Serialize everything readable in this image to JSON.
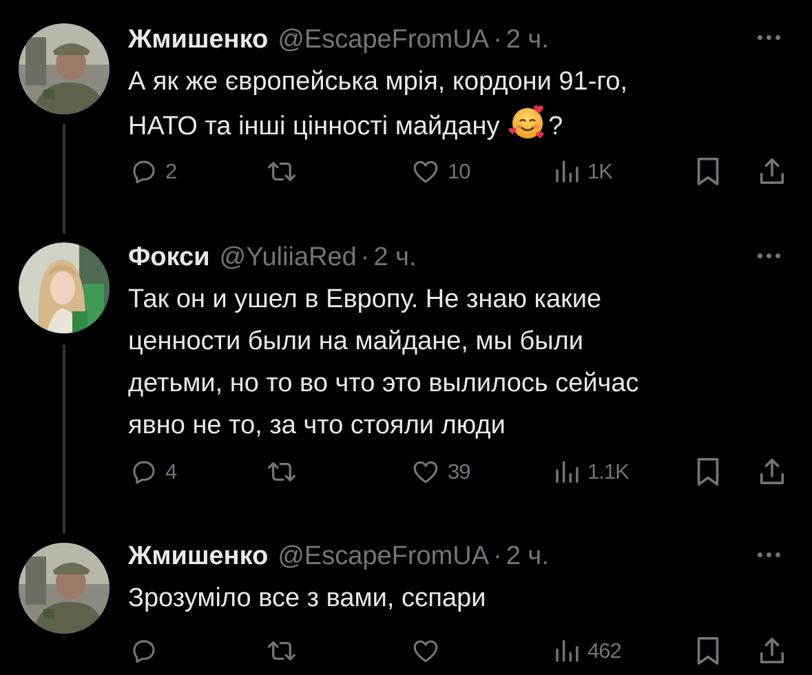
{
  "tweets": [
    {
      "name": "Жмишенко",
      "handle": "@EscapeFromUA",
      "separator": "·",
      "time": "2 ч.",
      "lines": [
        "А як же європейська мрія, кордони 91-го,",
        "НАТО та інші цінності майдану",
        "?"
      ],
      "emoji": "smiling-face-with-hearts",
      "replies": "2",
      "retweets": "",
      "likes": "10",
      "views": "1K"
    },
    {
      "name": "Фокси",
      "handle": "@YuliiaRed",
      "separator": "·",
      "time": "2 ч.",
      "lines": [
        "Так он и ушел в Европу. Не знаю какие",
        "ценности были на майдане, мы были",
        "детьми, но то во что это вылилось сейчас",
        "явно не то, за что стояли люди"
      ],
      "replies": "4",
      "retweets": "",
      "likes": "39",
      "views": "1.1K"
    },
    {
      "name": "Жмишенко",
      "handle": "@EscapeFromUA",
      "separator": "·",
      "time": "2 ч.",
      "lines": [
        "Зрозуміло все з вами, сєпари"
      ],
      "replies": "",
      "retweets": "",
      "likes": "",
      "views": "462"
    }
  ],
  "colors": {
    "background": "#000000",
    "text": "#e7e9ea",
    "secondary": "#71767b",
    "thread_line": "#333639"
  },
  "icons": {
    "reply": "speech-bubble-icon",
    "retweet": "retweet-arrows-icon",
    "like": "heart-icon",
    "views": "bar-chart-icon",
    "bookmark": "bookmark-icon",
    "share": "share-upload-icon",
    "more": "ellipsis-icon"
  }
}
